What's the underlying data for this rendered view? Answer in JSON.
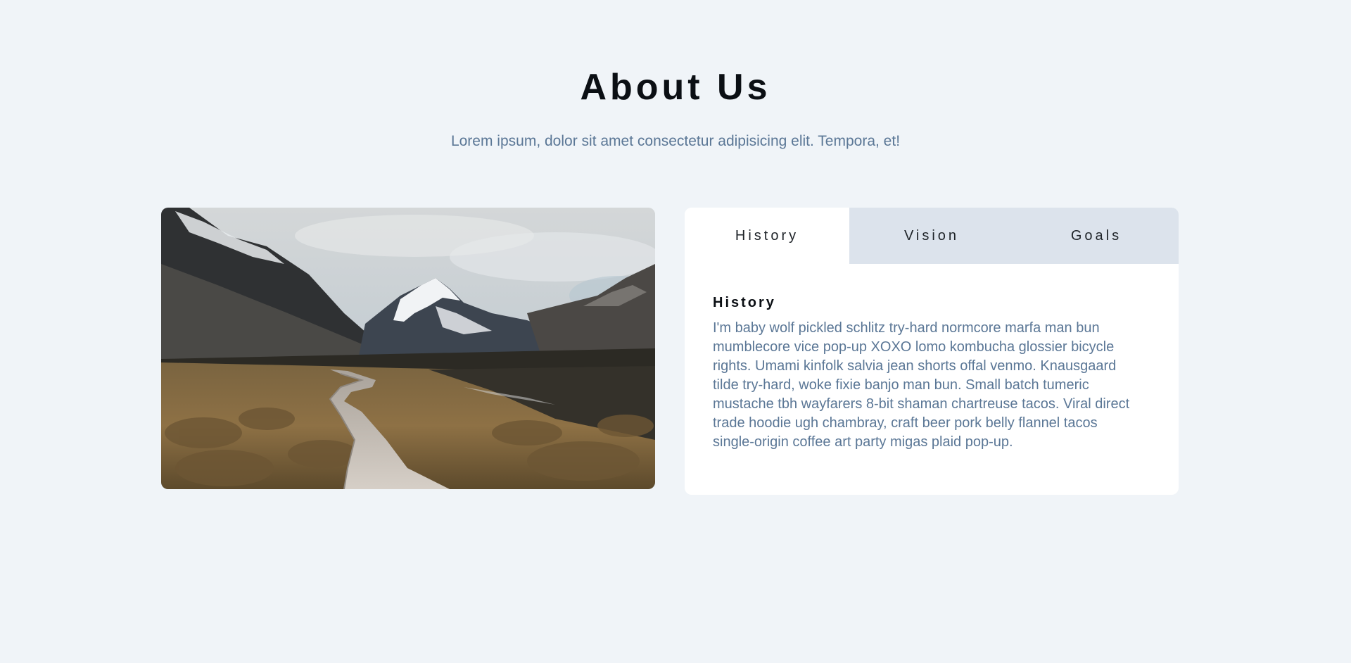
{
  "header": {
    "title": "About Us",
    "subtitle": "Lorem ipsum, dolor sit amet consectetur adipisicing elit. Tempora, et!"
  },
  "tabs": [
    {
      "label": "History",
      "active": true
    },
    {
      "label": "Vision",
      "active": false
    },
    {
      "label": "Goals",
      "active": false
    }
  ],
  "panel": {
    "title": "History",
    "body": "I'm baby wolf pickled schlitz try-hard normcore marfa man bun mumblecore vice pop-up XOXO lomo kombucha glossier bicycle rights. Umami kinfolk salvia jean shorts offal venmo. Knausgaard tilde try-hard, woke fixie banjo man bun. Small batch tumeric mustache tbh wayfarers 8-bit shaman chartreuse tacos. Viral direct trade hoodie ugh chambray, craft beer pork belly flannel tacos single-origin coffee art party migas plaid pop-up."
  },
  "colors": {
    "background": "#f0f4f8",
    "tab_inactive": "#dce3ec",
    "body_text": "#5b7796",
    "heading_text": "#0b0f14"
  }
}
